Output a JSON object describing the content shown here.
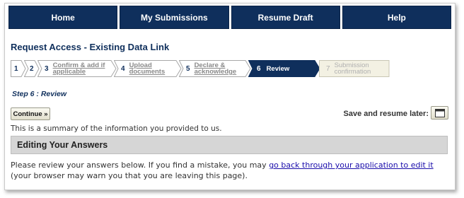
{
  "nav": {
    "tabs": [
      {
        "label": "Home"
      },
      {
        "label": "My Submissions"
      },
      {
        "label": "Resume Draft"
      },
      {
        "label": "Help"
      }
    ]
  },
  "page": {
    "title": "Request Access - Existing Data Link"
  },
  "steps": [
    {
      "number": "1",
      "label": "",
      "state": "completed"
    },
    {
      "number": "2",
      "label": "",
      "state": "completed"
    },
    {
      "number": "3",
      "label": "Confirm & add if\napplicable",
      "state": "completed"
    },
    {
      "number": "4",
      "label": "Upload\ndocuments",
      "state": "completed"
    },
    {
      "number": "5",
      "label": "Declare &\nacknowledge",
      "state": "completed"
    },
    {
      "number": "6",
      "label": "Review",
      "state": "current"
    },
    {
      "number": "7",
      "label": "Submission\nconfirmation",
      "state": "future"
    }
  ],
  "step_heading": "Step 6 : Review",
  "actions": {
    "continue_label": "Continue »",
    "save_label": "Save and resume later:",
    "save_icon": "calendar-icon"
  },
  "summary_text": "This is a summary of the information you provided to us.",
  "section": {
    "title": "Editing Your Answers"
  },
  "review": {
    "text_before": "Please review your answers below. If you find a mistake, you may ",
    "link_text": "go back through your application to edit it",
    "text_after": " (your browser may warn you that you are leaving this page)."
  },
  "colors": {
    "nav_bg": "#0f2f5c",
    "current_step_bg": "#0f2f5c",
    "future_step_bg": "#f3f1e3",
    "section_bar_bg": "#d6d6d6",
    "link": "#1a0dab"
  }
}
